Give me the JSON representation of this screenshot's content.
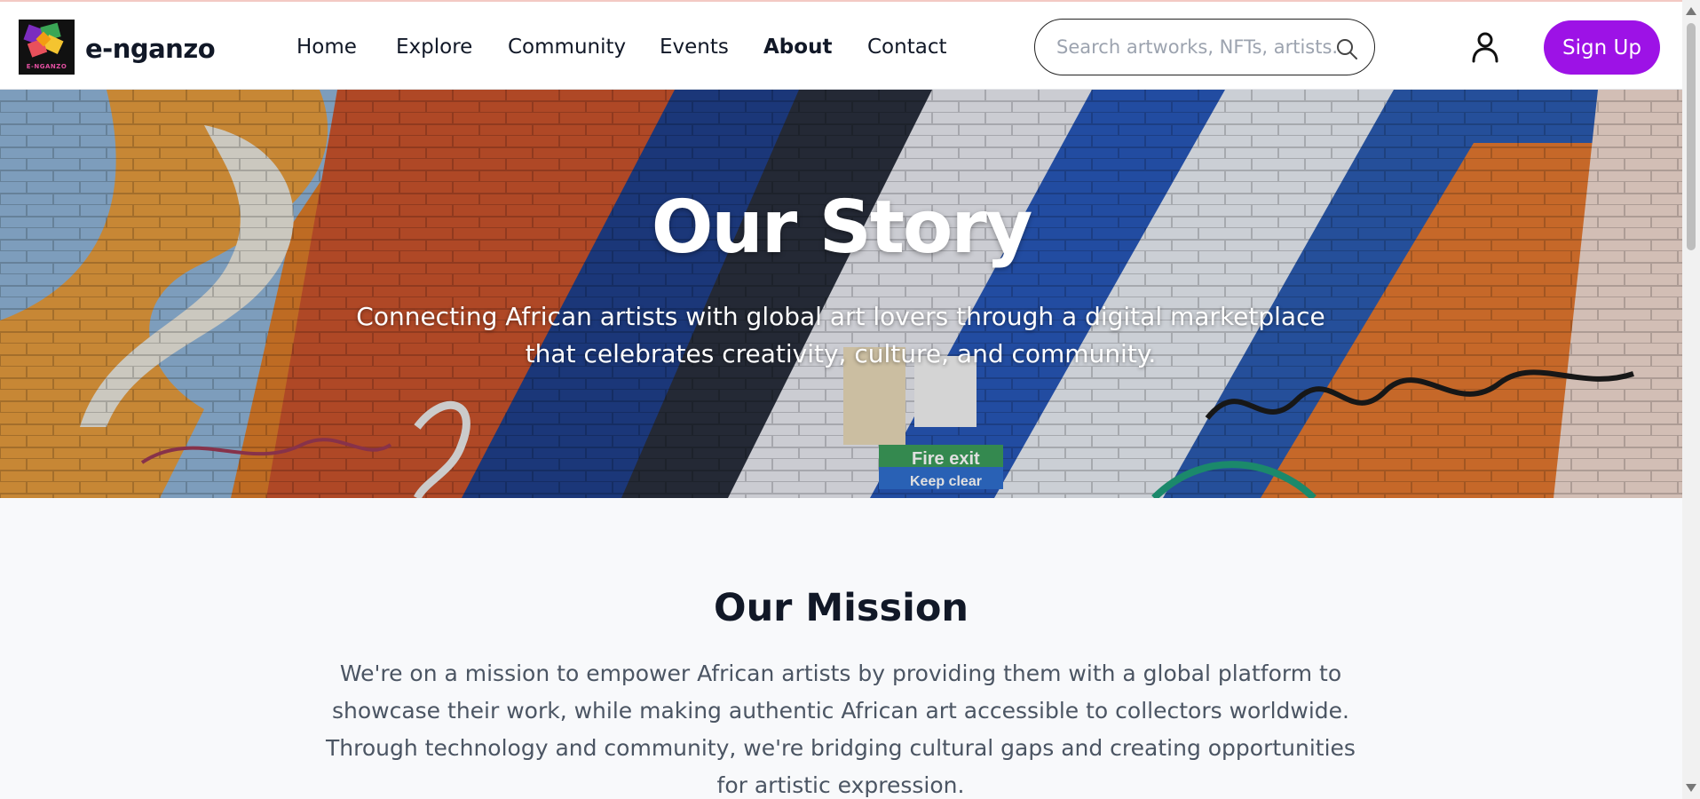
{
  "brand": {
    "name": "e-nganzo",
    "logo_caption": "E-NGANZO",
    "logo_icon": "pinwheel-logo-icon"
  },
  "nav": {
    "items": [
      {
        "label": "Home",
        "active": false
      },
      {
        "label": "Explore",
        "active": false
      },
      {
        "label": "Community",
        "active": false
      },
      {
        "label": "Events",
        "active": false
      },
      {
        "label": "About",
        "active": true
      },
      {
        "label": "Contact",
        "active": false
      }
    ]
  },
  "search": {
    "placeholder": "Search artworks, NFTs, artists...",
    "value": "",
    "icon": "search-icon"
  },
  "account": {
    "icon": "user-icon",
    "signup_label": "Sign Up"
  },
  "hero": {
    "title": "Our Story",
    "subtitle": "Connecting African artists with global art lovers through a digital marketplace that celebrates creativity, culture, and community."
  },
  "mission": {
    "title": "Our Mission",
    "text": "We're on a mission to empower African artists by providing them with a global platform to showcase their work, while making authentic African art accessible to collectors worldwide. Through technology and community, we're bridging cultural gaps and creating opportunities for artistic expression."
  },
  "colors": {
    "accent": "#9d12e6",
    "page_background": "#f8f9fb",
    "heading": "#111827",
    "body_text": "#4b5563"
  }
}
